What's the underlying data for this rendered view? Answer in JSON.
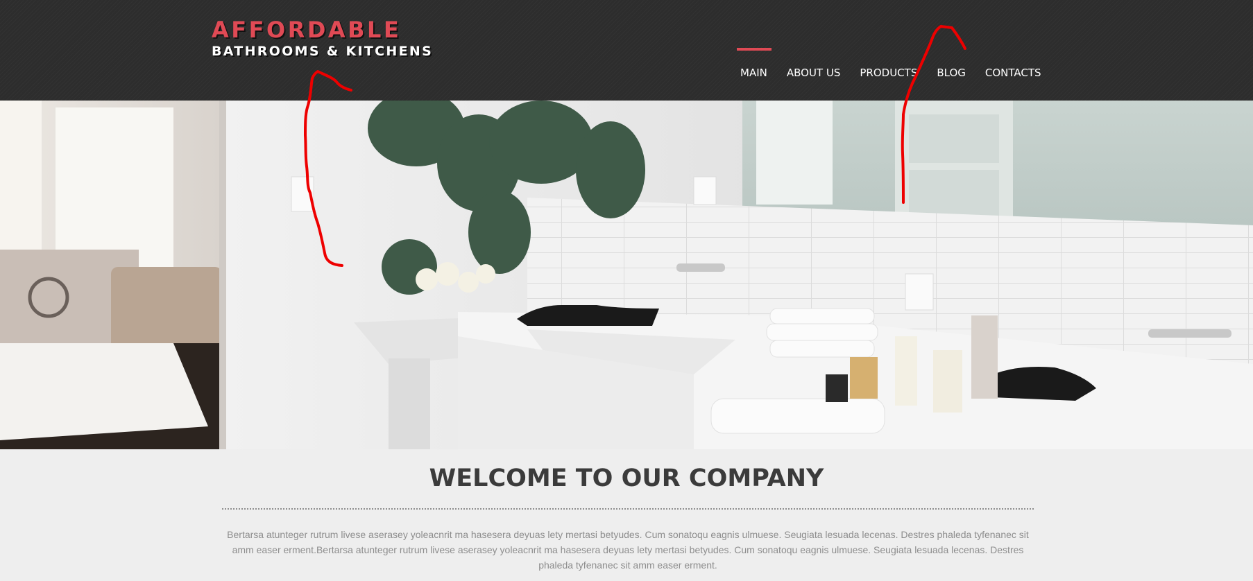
{
  "logo": {
    "line1": "AFFORDABLE",
    "line2": "BATHROOMS & KITCHENS"
  },
  "nav": {
    "items": [
      {
        "label": "MAIN",
        "active": true
      },
      {
        "label": "ABOUT US"
      },
      {
        "label": "PRODUCTS"
      },
      {
        "label": "BLOG"
      },
      {
        "label": "CONTACTS"
      }
    ]
  },
  "welcome": {
    "title": "WELCOME TO OUR COMPANY",
    "text": "Bertarsa atunteger rutrum livese aserasey yoleacnrit ma hasesera deyuas lety mertasi betyudes. Cum sonatoqu eagnis ulmuese. Seugiata lesuada lecenas. Destres phaleda tyfenanec sit amm easer erment.Bertarsa atunteger rutrum livese aserasey yoleacnrit ma hasesera deyuas lety mertasi betyudes. Cum sonatoqu eagnis ulmuese. Seugiata lesuada lecenas. Destres phaleda tyfenanec sit amm easer erment."
  },
  "colors": {
    "header_bg": "#2d2d2d",
    "accent": "#e04a55",
    "annotation": "#ee0000",
    "page_bg": "#eeeeee"
  }
}
